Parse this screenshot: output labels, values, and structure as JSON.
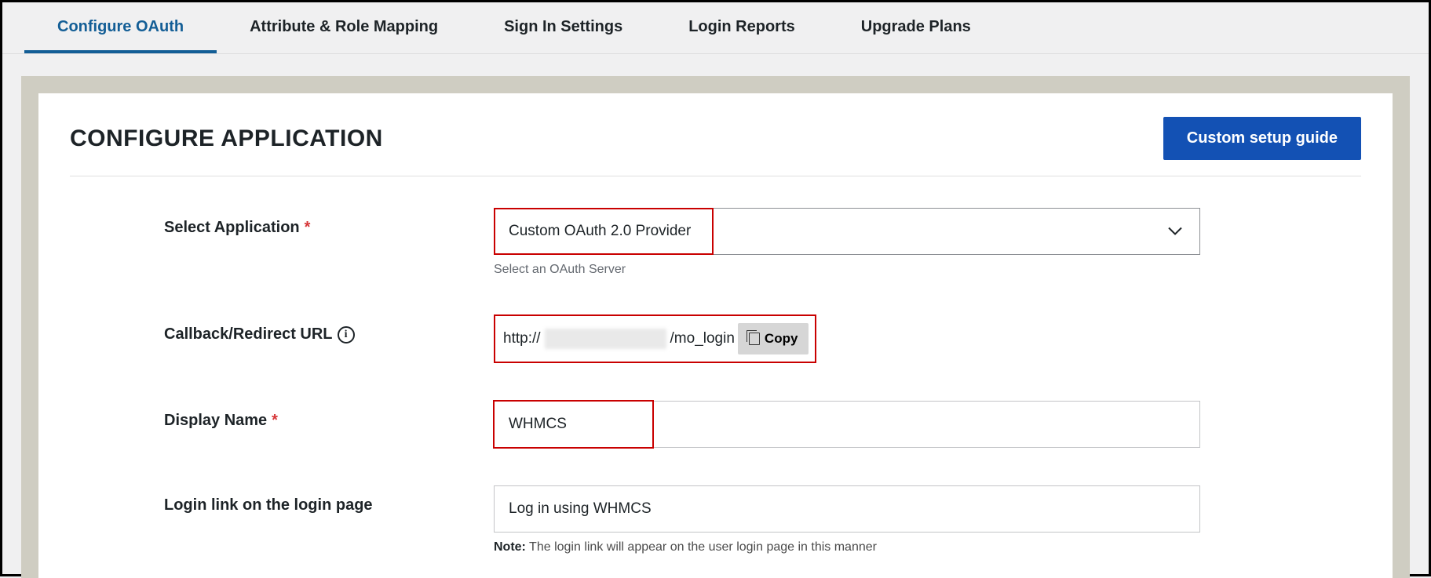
{
  "tabs": {
    "configure": "Configure OAuth",
    "attribute": "Attribute & Role Mapping",
    "signin": "Sign In Settings",
    "reports": "Login Reports",
    "upgrade": "Upgrade Plans"
  },
  "panel": {
    "title": "CONFIGURE APPLICATION",
    "guide_button": "Custom setup guide"
  },
  "form": {
    "select_app": {
      "label": "Select Application",
      "value": "Custom OAuth 2.0 Provider",
      "hint": "Select an OAuth Server"
    },
    "callback": {
      "label": "Callback/Redirect URL",
      "prefix": "http://",
      "suffix": "/mo_login",
      "copy": "Copy"
    },
    "display_name": {
      "label": "Display Name",
      "value": "WHMCS"
    },
    "login_link": {
      "label": "Login link on the login page",
      "value": "Log in using WHMCS",
      "note_label": "Note:",
      "note_text": " The login link will appear on the user login page in this manner"
    }
  }
}
